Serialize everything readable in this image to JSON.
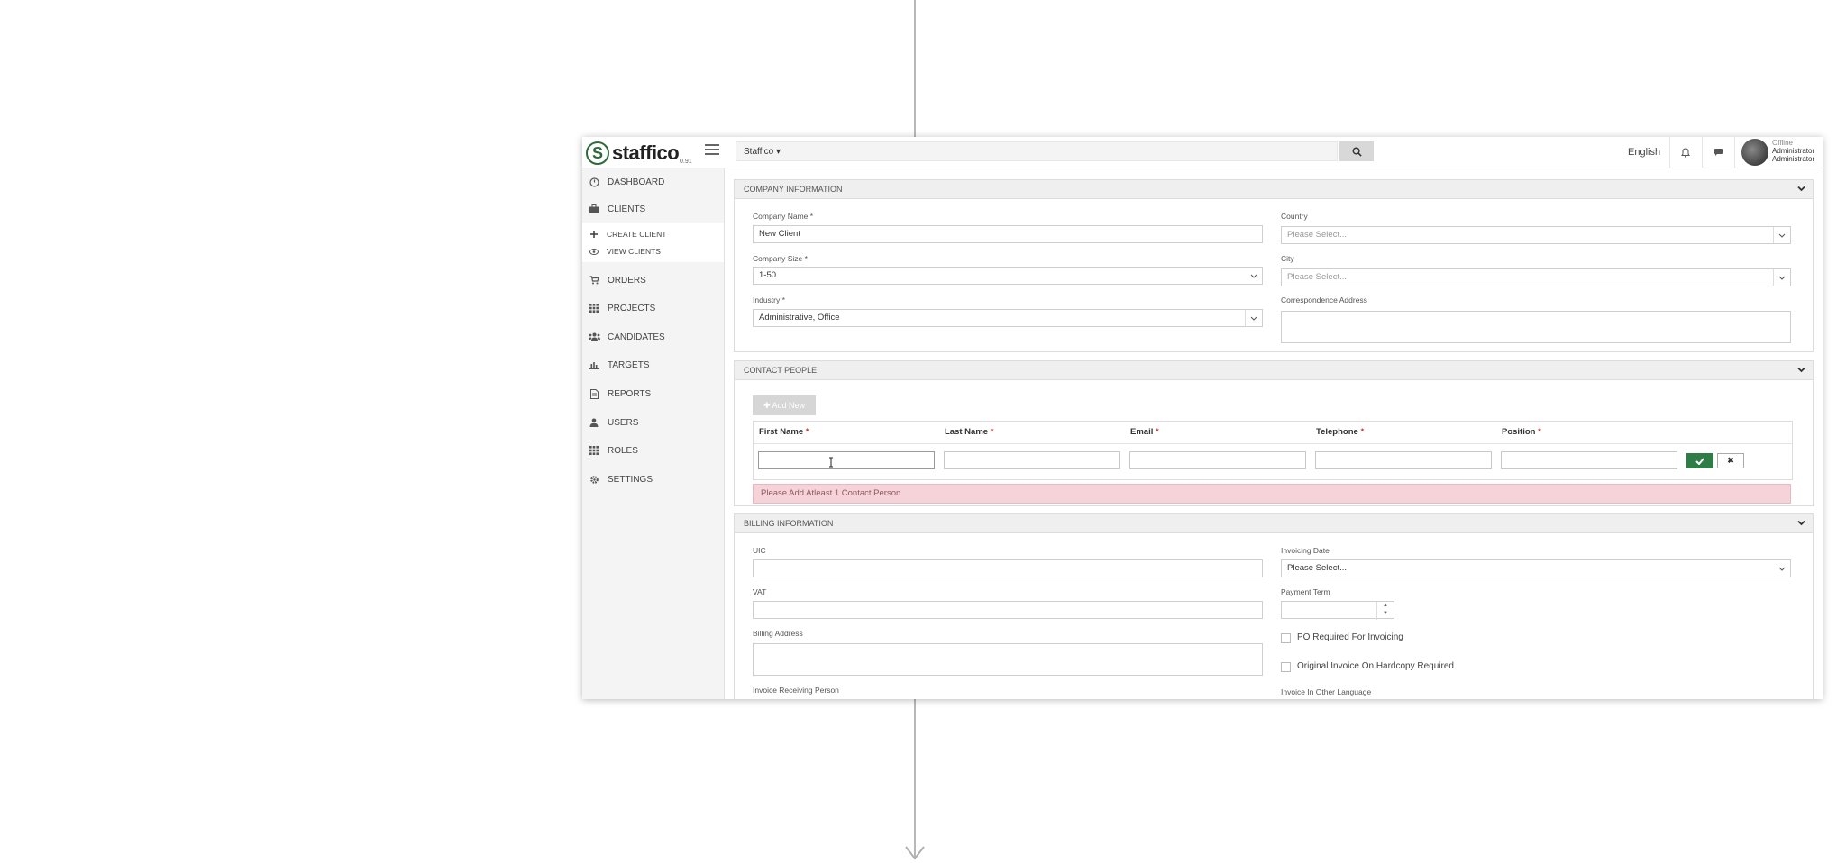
{
  "app": {
    "brand": "staffico",
    "version": "0.91",
    "company_switch": "Staffico ▾",
    "language": "English",
    "user": {
      "status": "Offline",
      "name": "Administrator",
      "role": "Administrator"
    }
  },
  "sidebar": {
    "items": [
      {
        "label": "DASHBOARD",
        "icon": "dashboard-icon"
      },
      {
        "label": "CLIENTS",
        "icon": "briefcase-icon"
      },
      {
        "label": "ORDERS",
        "icon": "cart-icon"
      },
      {
        "label": "PROJECTS",
        "icon": "grid-icon"
      },
      {
        "label": "CANDIDATES",
        "icon": "users-group-icon"
      },
      {
        "label": "TARGETS",
        "icon": "bar-chart-icon"
      },
      {
        "label": "REPORTS",
        "icon": "document-icon"
      },
      {
        "label": "USERS",
        "icon": "user-icon"
      },
      {
        "label": "ROLES",
        "icon": "grid-icon"
      },
      {
        "label": "SETTINGS",
        "icon": "gear-icon"
      }
    ],
    "sub_items": [
      {
        "label": "CREATE CLIENT",
        "icon": "plus-icon"
      },
      {
        "label": "VIEW CLIENTS",
        "icon": "eye-icon"
      }
    ]
  },
  "company_info": {
    "title": "COMPANY INFORMATION",
    "company_name_label": "Company Name *",
    "company_name_value": "New Client",
    "company_size_label": "Company Size *",
    "company_size_value": "1-50",
    "industry_label": "Industry *",
    "industry_value": "Administrative, Office",
    "country_label": "Country",
    "country_placeholder": "Please Select...",
    "city_label": "City",
    "city_placeholder": "Please Select...",
    "address_label": "Correspondence Address"
  },
  "contact_people": {
    "title": "CONTACT PEOPLE",
    "add_new": "✚ Add New",
    "columns": [
      "First Name",
      "Last Name",
      "Email",
      "Telephone",
      "Position"
    ],
    "required_mark": " *",
    "cancel_symbol": "✖",
    "error": "Please Add Atleast 1 Contact Person"
  },
  "billing": {
    "title": "BILLING INFORMATION",
    "uic_label": "UIC",
    "vat_label": "VAT",
    "billing_address_label": "Billing Address",
    "invoice_person_label": "Invoice Receiving Person",
    "invoicing_date_label": "Invoicing Date",
    "invoicing_date_value": "Please Select...",
    "payment_term_label": "Payment Term",
    "po_required_label": "PO Required For Invoicing",
    "original_invoice_label": "Original Invoice On Hardcopy Required",
    "other_language_label": "Invoice In Other Language"
  },
  "colors": {
    "brand_green": "#2f6b3a",
    "confirm_green": "#2e7d46",
    "error_bg": "#f6d3d8"
  }
}
